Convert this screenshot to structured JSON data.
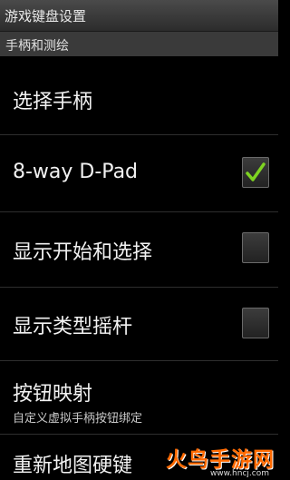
{
  "titlebar": {
    "title": "游戏键盘设置"
  },
  "section": {
    "title": "手柄和测绘"
  },
  "items": [
    {
      "label": "选择手柄"
    },
    {
      "label": "8-way D-Pad",
      "checked": true
    },
    {
      "label": "显示开始和选择",
      "checked": false
    },
    {
      "label": "显示类型摇杆",
      "checked": false
    },
    {
      "label": "按钮映射",
      "summary": "自定义虚拟手柄按钮绑定"
    },
    {
      "label": "重新地图硬键"
    }
  ],
  "watermark": {
    "logo": "火鸟手游网",
    "url": "www.hncj.com"
  },
  "colors": {
    "check": "#7ed321",
    "background": "#000000",
    "header": "#3a3a3a"
  }
}
